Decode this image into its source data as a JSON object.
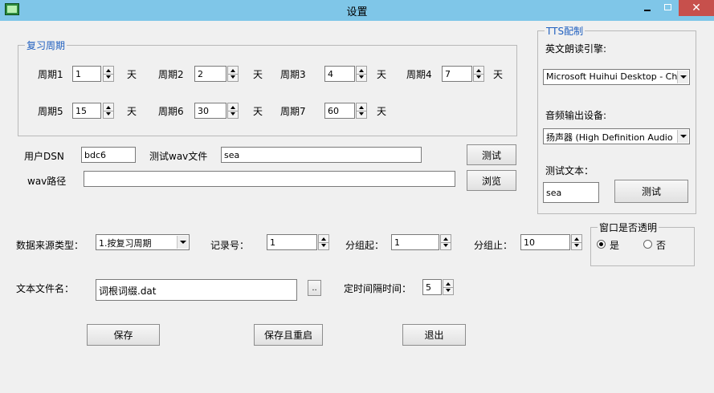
{
  "window": {
    "title": "设置",
    "close_glyph": "✕"
  },
  "review": {
    "legend": "复习周期",
    "unit": "天",
    "periods": [
      {
        "label": "周期1",
        "value": "1"
      },
      {
        "label": "周期2",
        "value": "2"
      },
      {
        "label": "周期3",
        "value": "4"
      },
      {
        "label": "周期4",
        "value": "7"
      },
      {
        "label": "周期5",
        "value": "15"
      },
      {
        "label": "周期6",
        "value": "30"
      },
      {
        "label": "周期7",
        "value": "60"
      }
    ]
  },
  "dsn": {
    "user_dsn_label": "用户DSN",
    "user_dsn_value": "bdc6",
    "test_wav_label": "测试wav文件",
    "test_wav_value": "sea",
    "test_button": "测试",
    "wav_path_label": "wav路径",
    "wav_path_value": "",
    "browse_button": "浏览"
  },
  "tts": {
    "legend": "TTS配制",
    "engine_label": "英文朗读引擎:",
    "engine_value": "Microsoft Huihui Desktop - Chi",
    "output_label": "音频输出设备:",
    "output_value": "扬声器 (High Definition Audio",
    "text_label": "测试文本：",
    "text_value": "sea",
    "test_button": "测试"
  },
  "data": {
    "source_type_label": "数据来源类型：",
    "source_type_value": "1.按复习周期",
    "record_label": "记录号：",
    "record_value": "1",
    "group_start_label": "分组起：",
    "group_start_value": "1",
    "group_end_label": "分组止：",
    "group_end_value": "10",
    "text_file_label": "文本文件名：",
    "text_file_value": "词根词缀.dat",
    "browse_glyph": "..",
    "interval_label": "定时间隔时间：",
    "interval_value": "5"
  },
  "transparency": {
    "legend": "窗口是否透明",
    "yes": "是",
    "no": "否",
    "selected": "是"
  },
  "actions": {
    "save": "保存",
    "save_restart": "保存且重启",
    "exit": "退出"
  }
}
